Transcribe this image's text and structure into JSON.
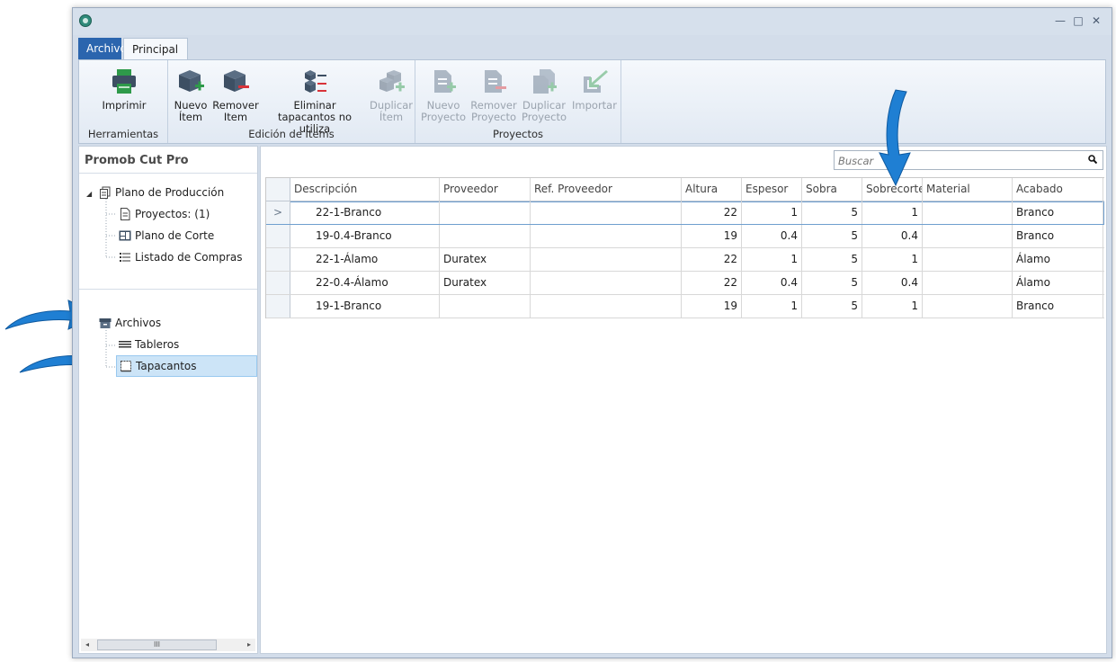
{
  "window": {
    "controls": {
      "minimize": "—",
      "maximize": "□",
      "close": "✕"
    }
  },
  "tabs": [
    {
      "label": "Archivo",
      "active": true
    },
    {
      "label": "Principal",
      "active": false
    }
  ],
  "ribbon": {
    "groups": [
      {
        "label": "Herramientas",
        "buttons": [
          {
            "label": "Imprimir",
            "icon": "printer-icon",
            "enabled": true
          }
        ]
      },
      {
        "label": "Edición de Ítems",
        "buttons": [
          {
            "label": "Nuevo\nÍtem",
            "icon": "new-item-icon",
            "enabled": true
          },
          {
            "label": "Remover\nItem",
            "icon": "remove-item-icon",
            "enabled": true
          },
          {
            "label": "Eliminar\ntapacantos no utiliza",
            "icon": "delete-unused-edges-icon",
            "enabled": true
          },
          {
            "label": "Duplicar\nÍtem",
            "icon": "duplicate-item-icon",
            "enabled": false
          }
        ]
      },
      {
        "label": "Proyectos",
        "buttons": [
          {
            "label": "Nuevo\nProyecto",
            "icon": "new-project-icon",
            "enabled": false
          },
          {
            "label": "Remover\nProyecto",
            "icon": "remove-project-icon",
            "enabled": false
          },
          {
            "label": "Duplicar\nProyecto",
            "icon": "duplicate-project-icon",
            "enabled": false
          },
          {
            "label": "Importar",
            "icon": "import-icon",
            "enabled": false
          }
        ]
      }
    ]
  },
  "sidebar": {
    "title": "Promob Cut Pro",
    "tree": {
      "expander": "◢",
      "plano_produccion": "Plano de Producción",
      "proyectos": "Proyectos: (1)",
      "plano_corte": "Plano de Corte",
      "listado_compras": "Listado de Compras",
      "archivos": "Archivos",
      "tableros": "Tableros",
      "tapacantos": "Tapacantos"
    },
    "scrollbar": {
      "left": "◂",
      "thumb": "III",
      "right": "▸"
    }
  },
  "search": {
    "placeholder": "Buscar"
  },
  "table": {
    "columns": [
      "Descripción",
      "Proveedor",
      "Ref. Proveedor",
      "Altura",
      "Espesor",
      "Sobra",
      "Sobrecorte",
      "Material",
      "Acabado"
    ],
    "current_row_marker": ">",
    "rows": [
      {
        "descripcion": "22-1-Branco",
        "proveedor": "",
        "ref": "",
        "altura": "22",
        "espesor": "1",
        "sobra": "5",
        "sobrecorte": "1",
        "material": "",
        "acabado": "Branco"
      },
      {
        "descripcion": "19-0.4-Branco",
        "proveedor": "",
        "ref": "",
        "altura": "19",
        "espesor": "0.4",
        "sobra": "5",
        "sobrecorte": "0.4",
        "material": "",
        "acabado": "Branco"
      },
      {
        "descripcion": "22-1-Álamo",
        "proveedor": "Duratex",
        "ref": "",
        "altura": "22",
        "espesor": "1",
        "sobra": "5",
        "sobrecorte": "1",
        "material": "",
        "acabado": "Álamo"
      },
      {
        "descripcion": "22-0.4-Álamo",
        "proveedor": "Duratex",
        "ref": "",
        "altura": "22",
        "espesor": "0.4",
        "sobra": "5",
        "sobrecorte": "0.4",
        "material": "",
        "acabado": "Álamo"
      },
      {
        "descripcion": "19-1-Branco",
        "proveedor": "",
        "ref": "",
        "altura": "19",
        "espesor": "1",
        "sobra": "5",
        "sobrecorte": "1",
        "material": "",
        "acabado": "Branco"
      }
    ]
  },
  "colors": {
    "accent": "#2b65ae",
    "selection": "#cce4f7",
    "callout_arrow": "#1f7fd3"
  }
}
